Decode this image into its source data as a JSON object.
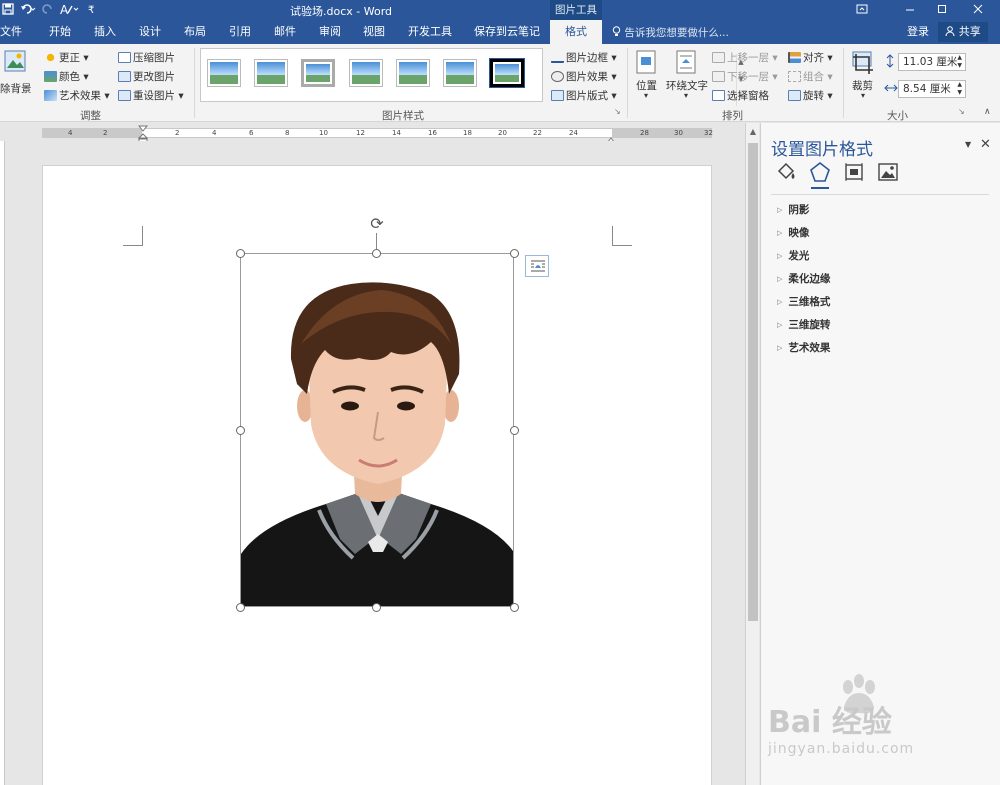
{
  "title_bar": {
    "document_title": "试验场.docx - Word",
    "context_tools": "图片工具",
    "qat_icons": [
      "save-icon",
      "undo-icon",
      "redo-icon",
      "format-painter-icon",
      "customize-icon"
    ],
    "window_buttons": [
      "ribbon-options-icon",
      "minimize-icon",
      "maximize-icon",
      "close-icon"
    ]
  },
  "tabs": [
    {
      "label": "文件"
    },
    {
      "label": "开始"
    },
    {
      "label": "插入"
    },
    {
      "label": "设计"
    },
    {
      "label": "布局"
    },
    {
      "label": "引用"
    },
    {
      "label": "邮件"
    },
    {
      "label": "审阅"
    },
    {
      "label": "视图"
    },
    {
      "label": "开发工具"
    },
    {
      "label": "保存到云笔记"
    },
    {
      "label": "格式"
    }
  ],
  "active_tab": "格式",
  "tell_me": "告诉我您想要做什么...",
  "login": "登录",
  "share": "共享",
  "ribbon": {
    "adjust": {
      "remove_background": "除背景",
      "corrections": "更正",
      "color": "颜色",
      "artistic_effects": "艺术效果",
      "compress": "压缩图片",
      "change_picture": "更改图片",
      "reset_picture": "重设图片",
      "group_label": "调整"
    },
    "styles": {
      "border": "图片边框",
      "effects": "图片效果",
      "layout": "图片版式",
      "group_label": "图片样式",
      "thumb_count": 7,
      "selected_thumb": 7
    },
    "arrange": {
      "position": "位置",
      "wrap_text": "环绕文字",
      "bring_forward": "上移一层",
      "send_backward": "下移一层",
      "selection_pane": "选择窗格",
      "align": "对齐",
      "group": "组合",
      "rotate": "旋转",
      "group_label": "排列"
    },
    "size": {
      "crop": "裁剪",
      "height": "11.03 厘米",
      "width": "8.54 厘米",
      "group_label": "大小"
    }
  },
  "ruler_ticks": [
    "4",
    "2",
    "2",
    "4",
    "6",
    "8",
    "10",
    "12",
    "14",
    "16",
    "18",
    "20",
    "22",
    "24",
    "28",
    "30",
    "32"
  ],
  "pane": {
    "title": "设置图片格式",
    "tab_icons": [
      "fill-line-icon",
      "effects-icon",
      "layout-properties-icon",
      "picture-icon"
    ],
    "active_tab_icon": "effects-icon",
    "sections": [
      {
        "label": "阴影"
      },
      {
        "label": "映像"
      },
      {
        "label": "发光"
      },
      {
        "label": "柔化边缘"
      },
      {
        "label": "三维格式"
      },
      {
        "label": "三维旋转"
      },
      {
        "label": "艺术效果"
      }
    ]
  },
  "watermark": {
    "main": "Bai 经验",
    "url": "jingyan.baidu.com"
  },
  "colors": {
    "accent": "#2b579a",
    "ribbon_bg": "#f3f3f3",
    "doc_bg": "#e6e6e6"
  }
}
